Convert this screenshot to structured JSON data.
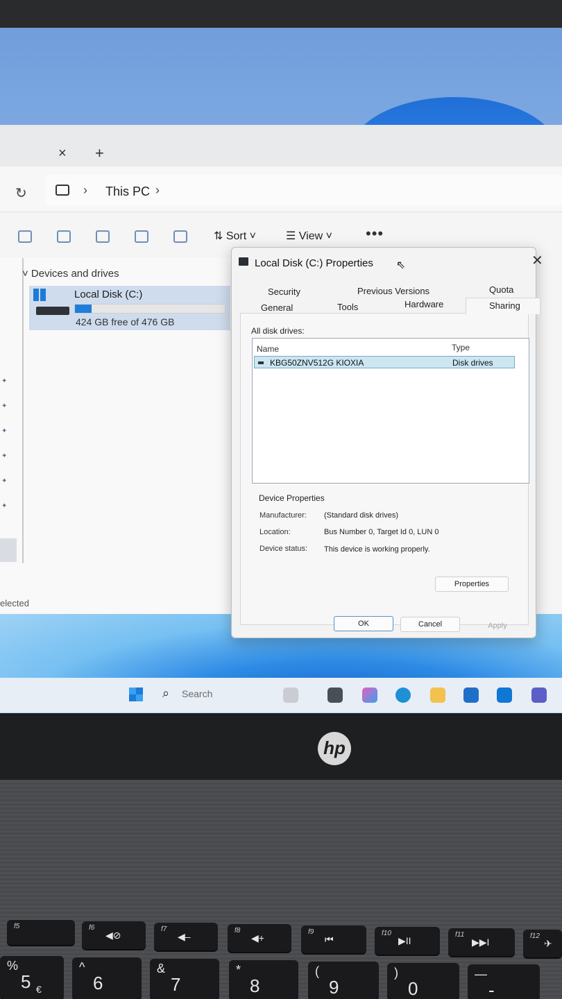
{
  "explorer": {
    "tab_close": "×",
    "tab_add": "+",
    "refresh_glyph": "↻",
    "breadcrumb": "This PC",
    "chevron": "›",
    "toolbar": {
      "sort": "⇅ Sort ˅",
      "view": "☰ View ˅",
      "more": "•••"
    },
    "group_header": "˅  Devices and drives",
    "drive": {
      "name": "Local Disk (C:)",
      "free": "424 GB free of 476 GB",
      "used_fraction": 0.11
    },
    "status": "elected"
  },
  "taskbar": {
    "search_placeholder": "Search"
  },
  "dialog": {
    "title": "Local Disk (C:) Properties",
    "close": "✕",
    "tabs_row1": [
      "Security",
      "Previous Versions",
      "Quota"
    ],
    "tabs_row2": [
      "General",
      "Tools",
      "Hardware",
      "Sharing"
    ],
    "active_tab": "Sharing",
    "all_disk_drives_label": "All disk drives:",
    "columns": {
      "name": "Name",
      "type": "Type"
    },
    "drives": [
      {
        "name": "KBG50ZNV512G KIOXIA",
        "type": "Disk drives"
      }
    ],
    "device_properties_header": "Device Properties",
    "properties": [
      {
        "key": "Manufacturer:",
        "value": "(Standard disk drives)"
      },
      {
        "key": "Location:",
        "value": "Bus Number 0, Target Id 0, LUN 0"
      },
      {
        "key": "Device status:",
        "value": "This device is working properly."
      }
    ],
    "buttons": {
      "properties": "Properties",
      "ok": "OK",
      "cancel": "Cancel",
      "apply": "Apply"
    }
  },
  "laptop": {
    "brand": "hp"
  },
  "keyboard": {
    "fn_keys": [
      {
        "label": "f5",
        "symbol": ""
      },
      {
        "label": "f6",
        "symbol": "◀⊘"
      },
      {
        "label": "f7",
        "symbol": "◀–"
      },
      {
        "label": "f8",
        "symbol": "◀+"
      },
      {
        "label": "f9",
        "symbol": "⏮"
      },
      {
        "label": "f10",
        "symbol": "▶II"
      },
      {
        "label": "f11",
        "symbol": "▶▶I"
      },
      {
        "label": "f12",
        "symbol": "✈"
      }
    ],
    "number_keys": [
      {
        "top": "%",
        "main": "5",
        "extra": "€"
      },
      {
        "top": "^",
        "main": "6",
        "extra": ""
      },
      {
        "top": "&",
        "main": "7",
        "extra": ""
      },
      {
        "top": "*",
        "main": "8",
        "extra": ""
      },
      {
        "top": "(",
        "main": "9",
        "extra": ""
      },
      {
        "top": ")",
        "main": "0",
        "extra": ""
      },
      {
        "top": "—",
        "main": "-",
        "extra": ""
      }
    ]
  }
}
